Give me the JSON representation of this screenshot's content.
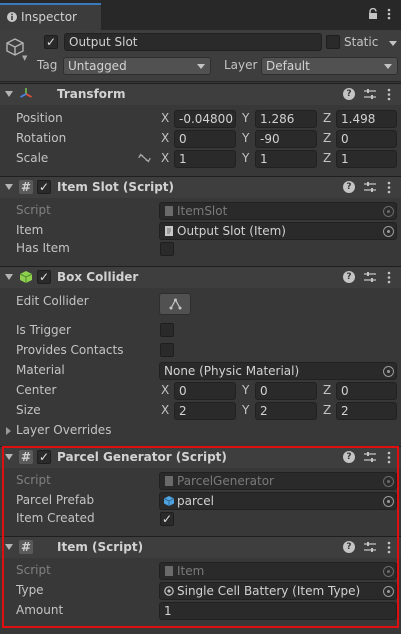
{
  "tab": {
    "title": "Inspector",
    "icon": "info-icon"
  },
  "gameobject": {
    "name": "Output Slot",
    "active": true,
    "static_label": "Static",
    "static_checked": false,
    "tag_label": "Tag",
    "tag_value": "Untagged",
    "layer_label": "Layer",
    "layer_value": "Default"
  },
  "transform": {
    "title": "Transform",
    "position": {
      "label": "Position",
      "x": "-0.04800",
      "y": "1.286",
      "z": "1.498"
    },
    "rotation": {
      "label": "Rotation",
      "x": "0",
      "y": "-90",
      "z": "0"
    },
    "scale": {
      "label": "Scale",
      "x": "1",
      "y": "1",
      "z": "1"
    },
    "axis_labels": [
      "X",
      "Y",
      "Z"
    ]
  },
  "item_slot": {
    "title": "Item Slot (Script)",
    "enabled": true,
    "script_label": "Script",
    "script_value": "ItemSlot",
    "item_label": "Item",
    "item_value": "Output Slot (Item)",
    "has_item_label": "Has Item",
    "has_item": false
  },
  "box_collider": {
    "title": "Box Collider",
    "enabled": true,
    "edit_collider_label": "Edit Collider",
    "is_trigger_label": "Is Trigger",
    "is_trigger": false,
    "provides_contacts_label": "Provides Contacts",
    "provides_contacts": false,
    "material_label": "Material",
    "material_value": "None (Physic Material)",
    "center": {
      "label": "Center",
      "x": "0",
      "y": "0",
      "z": "0"
    },
    "size": {
      "label": "Size",
      "x": "2",
      "y": "2",
      "z": "2"
    },
    "layer_overrides_label": "Layer Overrides"
  },
  "parcel_generator": {
    "title": "Parcel Generator (Script)",
    "enabled": true,
    "script_label": "Script",
    "script_value": "ParcelGenerator",
    "parcel_prefab_label": "Parcel Prefab",
    "parcel_prefab_value": "parcel",
    "item_created_label": "Item Created",
    "item_created": true
  },
  "item": {
    "title": "Item (Script)",
    "script_label": "Script",
    "script_value": "Item",
    "type_label": "Type",
    "type_value": "Single Cell Battery (Item Type)",
    "amount_label": "Amount",
    "amount_value": "1"
  },
  "colors": {
    "highlight": "#e00f0f",
    "accent": "#3a79bb"
  }
}
